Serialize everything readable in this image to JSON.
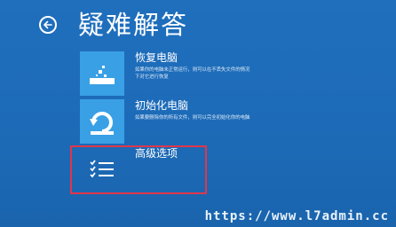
{
  "header": {
    "title": "疑难解答"
  },
  "options": [
    {
      "title": "恢复电脑",
      "description": "如果你的电脑未正常运行，则可以在不丢失文件的情况下对它进行恢复",
      "icon": "restore-icon"
    },
    {
      "title": "初始化电脑",
      "description": "如果要删除你的所有文件，则可以完全初始化你的电脑",
      "icon": "reset-icon"
    },
    {
      "title": "高级选项",
      "description": "",
      "icon": "checklist-icon"
    }
  ],
  "watermark": "https://www.l7admin.cc",
  "colors": {
    "background": "#1d6bb8",
    "tile": "#3aa0e6",
    "highlight": "#e0364a"
  }
}
